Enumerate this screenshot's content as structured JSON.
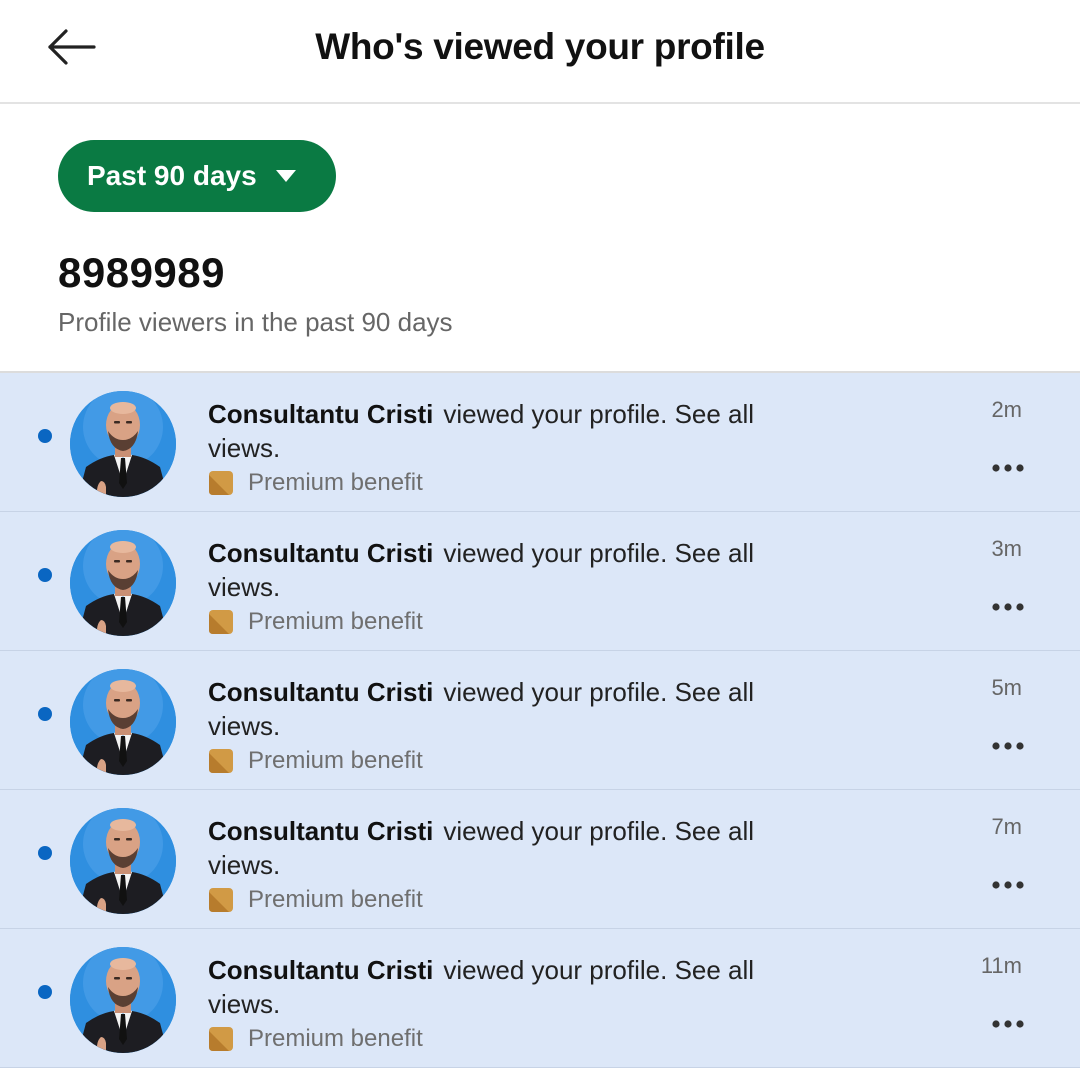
{
  "header": {
    "title": "Who's viewed your profile",
    "back_icon": "arrow-left-icon"
  },
  "summary": {
    "filter_label": "Past 90 days",
    "filter_icon": "caret-down-icon",
    "count": "8989989",
    "caption": "Profile viewers in the past 90 days"
  },
  "colors": {
    "accent_green": "#0a7a43",
    "row_background": "#dce7f8",
    "unread_dot": "#0a66c2",
    "premium_gold": "#d19a45"
  },
  "viewers": [
    {
      "name": "Consultantu Cristi",
      "message": "viewed your profile. See all views.",
      "time": "2m",
      "badge": "Premium benefit",
      "unread": true
    },
    {
      "name": "Consultantu Cristi",
      "message": "viewed your profile. See all views.",
      "time": "3m",
      "badge": "Premium benefit",
      "unread": true
    },
    {
      "name": "Consultantu Cristi",
      "message": "viewed your profile. See all views.",
      "time": "5m",
      "badge": "Premium benefit",
      "unread": true
    },
    {
      "name": "Consultantu Cristi",
      "message": "viewed your profile. See all views.",
      "time": "7m",
      "badge": "Premium benefit",
      "unread": true
    },
    {
      "name": "Consultantu Cristi",
      "message": "viewed your profile. See all views.",
      "time": "11m",
      "badge": "Premium benefit",
      "unread": true
    }
  ]
}
